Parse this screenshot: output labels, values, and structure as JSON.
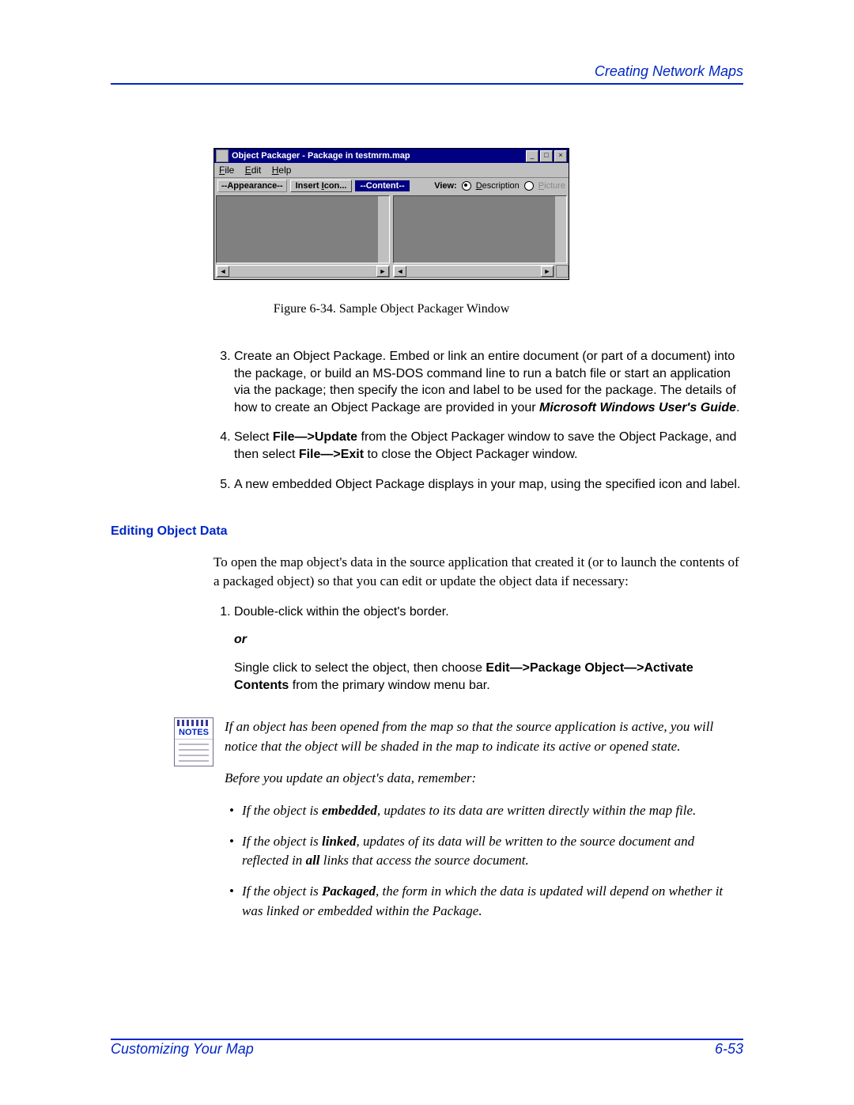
{
  "header": {
    "right": "Creating Network Maps"
  },
  "window": {
    "title": "Object Packager - Package in testmrm.map",
    "menus": {
      "file": "File",
      "edit": "Edit",
      "help": "Help"
    },
    "toolbar": {
      "appearance": "--Appearance--",
      "insert_icon": "Insert Icon...",
      "content": "--Content--",
      "view_label": "View:",
      "description": "Description",
      "picture": "Picture"
    }
  },
  "figure_caption": "Figure 6-34.  Sample Object Packager Window",
  "steps_a": {
    "s3_a": "Create an Object Package. Embed or link an entire document (or part of a document) into the package, or build an MS-DOS command line to run a batch file or start an application via the package; then specify the icon and label to be used for the package. The details of how to create an Object Package are provided in your ",
    "s3_b": "Microsoft Windows User's Guide",
    "s3_c": ".",
    "s4_a": "Select ",
    "s4_b": "File—>Update",
    "s4_c": " from the Object Packager window to save the Object Package, and then select ",
    "s4_d": "File—>Exit",
    "s4_e": " to close the Object Packager window.",
    "s5": "A new embedded Object Package displays in your map, using the specified icon and label."
  },
  "section2": {
    "heading": "Editing Object Data",
    "intro": "To open the map object's data in the source application that created it (or to launch the contents of a packaged object) so that you can edit or update the object data if necessary:",
    "s1": "Double-click within the object's border.",
    "or": "or",
    "s1b_a": "Single click to select the object, then choose ",
    "s1b_b": "Edit—>Package Object—>Activate Contents",
    "s1b_c": " from the primary window menu bar."
  },
  "notes": {
    "label": "NOTES",
    "p1": "If an object has been opened from the map so that the source application is active, you will notice that the object will be shaded in the map to indicate its active or opened state.",
    "p2": "Before you update an object's data, remember:",
    "b1_a": "If the object is ",
    "b1_b": "embedded",
    "b1_c": ", updates to its data are written directly within the map file.",
    "b2_a": "If the object is ",
    "b2_b": "linked",
    "b2_c": ", updates of its data will be written to the source document and reflected in ",
    "b2_d": "all",
    "b2_e": " links that access the source document.",
    "b3_a": "If the object is ",
    "b3_b": "Packaged",
    "b3_c": ", the form in which the data is updated will depend on whether it was linked or embedded within the Package."
  },
  "footer": {
    "left": "Customizing Your Map",
    "right": "6-53"
  }
}
